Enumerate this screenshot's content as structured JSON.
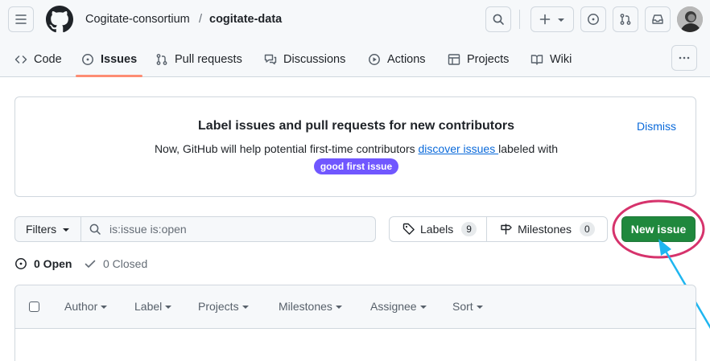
{
  "header": {
    "owner": "Cogitate-consortium",
    "separator": "/",
    "repo": "cogitate-data"
  },
  "nav": {
    "tabs": [
      {
        "label": "Code",
        "icon": "code-icon"
      },
      {
        "label": "Issues",
        "icon": "issue-opened-icon",
        "active": true
      },
      {
        "label": "Pull requests",
        "icon": "git-pull-request-icon"
      },
      {
        "label": "Discussions",
        "icon": "comment-discussion-icon"
      },
      {
        "label": "Actions",
        "icon": "play-icon"
      },
      {
        "label": "Projects",
        "icon": "table-icon"
      },
      {
        "label": "Wiki",
        "icon": "book-icon"
      }
    ]
  },
  "banner": {
    "title": "Label issues and pull requests for new contributors",
    "text_before": "Now, GitHub will help potential first-time contributors ",
    "link": "discover issues ",
    "text_after": "labeled with",
    "badge": "good first issue",
    "dismiss": "Dismiss"
  },
  "toolbar": {
    "filters_label": "Filters",
    "search_value": "is:issue is:open",
    "labels_label": "Labels",
    "labels_count": "9",
    "milestones_label": "Milestones",
    "milestones_count": "0",
    "new_issue_label": "New issue"
  },
  "states": {
    "open": "0 Open",
    "closed": "0 Closed"
  },
  "list_header": {
    "filters": [
      "Author",
      "Label",
      "Projects",
      "Milestones",
      "Assignee",
      "Sort"
    ]
  },
  "colors": {
    "accent_green": "#1f883d",
    "link_blue": "#0969da",
    "badge_purple": "#7057ff",
    "annotation_pink": "#d6336c",
    "annotation_arrow": "#1fb6f0",
    "tab_underline": "#fd8c73"
  }
}
